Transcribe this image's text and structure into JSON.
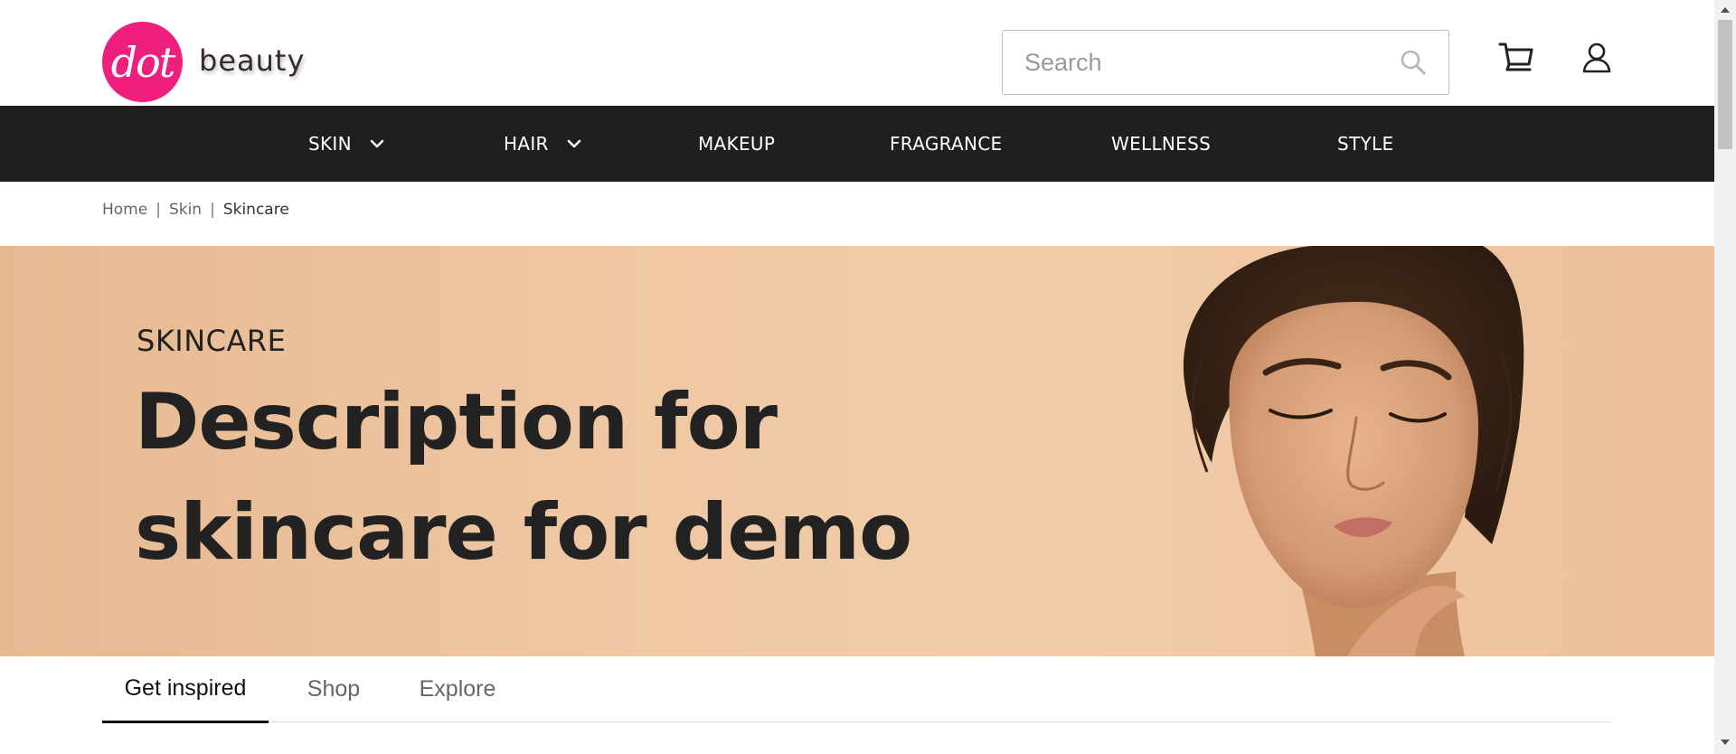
{
  "brand": {
    "logo_mark": "dot",
    "logo_text": "beauty",
    "logo_color": "#ef1f7f"
  },
  "search": {
    "placeholder": "Search",
    "value": "",
    "icon": "search-icon"
  },
  "header_icons": {
    "cart": "cart-icon",
    "account": "user-icon"
  },
  "nav": {
    "background": "#1f1f1f",
    "items": [
      {
        "label": "SKIN",
        "has_dropdown": true
      },
      {
        "label": "HAIR",
        "has_dropdown": true
      },
      {
        "label": "MAKEUP",
        "has_dropdown": false
      },
      {
        "label": "FRAGRANCE",
        "has_dropdown": false
      },
      {
        "label": "WELLNESS",
        "has_dropdown": false
      },
      {
        "label": "STYLE",
        "has_dropdown": false
      }
    ]
  },
  "breadcrumb": {
    "items": [
      "Home",
      "Skin",
      "Skincare"
    ],
    "separator": "|"
  },
  "hero": {
    "eyebrow": "SKINCARE",
    "title": "Description for skincare for demo",
    "background": "#efc7a3"
  },
  "tabs": {
    "items": [
      "Get inspired",
      "Shop",
      "Explore"
    ],
    "active": "Get inspired"
  }
}
